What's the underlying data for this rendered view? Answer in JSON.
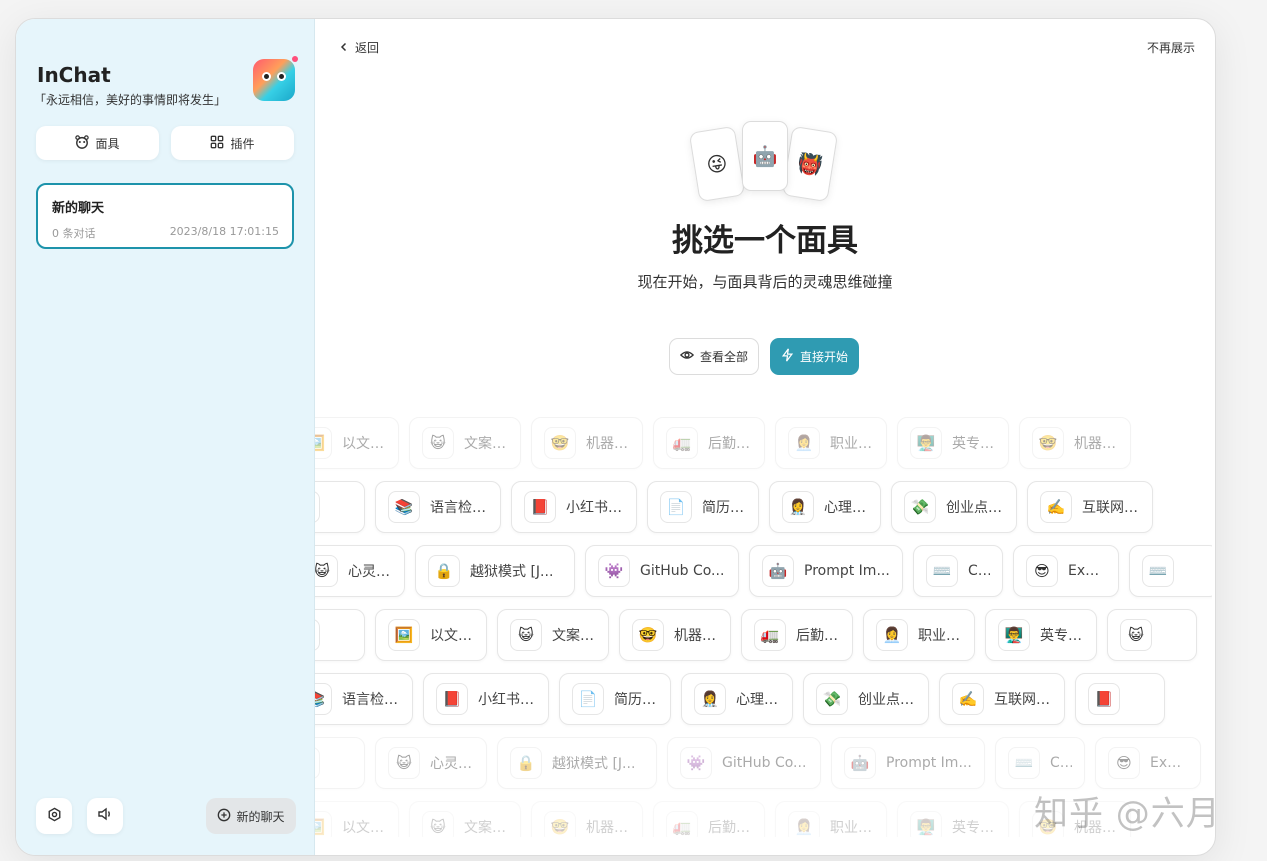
{
  "sidebar": {
    "title": "InChat",
    "subtitle": "「永远相信，美好的事情即将发生」",
    "masks_button": "面具",
    "plugins_button": "插件",
    "chat": {
      "title": "新的聊天",
      "count": "0 条对话",
      "time": "2023/8/18 17:01:15"
    },
    "new_chat_button": "新的聊天"
  },
  "main": {
    "back_label": "返回",
    "hide_label": "不再展示",
    "emoji_cards": [
      "😜",
      "🤖",
      "👹"
    ],
    "title": "挑选一个面具",
    "subtitle": "现在开始，与面具背后的灵魂思维碰撞",
    "view_all_button": "查看全部",
    "start_button": "直接开始",
    "mask_rows": [
      [
        {
          "icon": "🖼️",
          "label": "以文搜图"
        },
        {
          "icon": "😺",
          "label": "文案写手"
        },
        {
          "icon": "🤓",
          "label": "机器学习"
        },
        {
          "icon": "🚛",
          "label": "后勤工作"
        },
        {
          "icon": "👩‍💼",
          "label": "职业顾问"
        },
        {
          "icon": "👨‍🏫",
          "label": "英专写手"
        },
        {
          "icon": "🤓",
          "label": "机器学习"
        }
      ],
      [
        {
          "icon": "",
          "label": ""
        },
        {
          "icon": "📚",
          "label": "语言检测器"
        },
        {
          "icon": "📕",
          "label": "小红书写手"
        },
        {
          "icon": "📄",
          "label": "简历写手"
        },
        {
          "icon": "👩‍⚕️",
          "label": "心理医生"
        },
        {
          "icon": "💸",
          "label": "创业点子王"
        },
        {
          "icon": "✍️",
          "label": "互联网写手"
        }
      ],
      [
        {
          "icon": "😺",
          "label": "心灵导师"
        },
        {
          "icon": "🔒",
          "label": "越狱模式 [J..."
        },
        {
          "icon": "👾",
          "label": "GitHub Co..."
        },
        {
          "icon": "🤖",
          "label": "Prompt Im..."
        },
        {
          "icon": "⌨️",
          "label": "CAN"
        },
        {
          "icon": "😎",
          "label": "Expert"
        },
        {
          "icon": "⌨️",
          "label": ""
        }
      ],
      [
        {
          "icon": "",
          "label": ""
        },
        {
          "icon": "🖼️",
          "label": "以文搜图"
        },
        {
          "icon": "😺",
          "label": "文案写手"
        },
        {
          "icon": "🤓",
          "label": "机器学习"
        },
        {
          "icon": "🚛",
          "label": "后勤工作"
        },
        {
          "icon": "👩‍💼",
          "label": "职业顾问"
        },
        {
          "icon": "👨‍🏫",
          "label": "英专写手"
        },
        {
          "icon": "😺",
          "label": ""
        }
      ],
      [
        {
          "icon": "📚",
          "label": "语言检测器"
        },
        {
          "icon": "📕",
          "label": "小红书写手"
        },
        {
          "icon": "📄",
          "label": "简历写手"
        },
        {
          "icon": "👩‍⚕️",
          "label": "心理医生"
        },
        {
          "icon": "💸",
          "label": "创业点子王"
        },
        {
          "icon": "✍️",
          "label": "互联网写手"
        },
        {
          "icon": "📕",
          "label": ""
        }
      ],
      [
        {
          "icon": "",
          "label": ""
        },
        {
          "icon": "😺",
          "label": "心灵导师"
        },
        {
          "icon": "🔒",
          "label": "越狱模式 [J..."
        },
        {
          "icon": "👾",
          "label": "GitHub Co..."
        },
        {
          "icon": "🤖",
          "label": "Prompt Im..."
        },
        {
          "icon": "⌨️",
          "label": "CAN"
        },
        {
          "icon": "😎",
          "label": "Expert"
        }
      ],
      [
        {
          "icon": "🖼️",
          "label": "以文搜图"
        },
        {
          "icon": "😺",
          "label": "文案写手"
        },
        {
          "icon": "🤓",
          "label": "机器学习"
        },
        {
          "icon": "🚛",
          "label": "后勤工作"
        },
        {
          "icon": "👩‍💼",
          "label": "职业顾问"
        },
        {
          "icon": "👨‍🏫",
          "label": "英专写手"
        },
        {
          "icon": "🤓",
          "label": "机器学习"
        }
      ]
    ]
  },
  "watermark": "知乎 @六月"
}
